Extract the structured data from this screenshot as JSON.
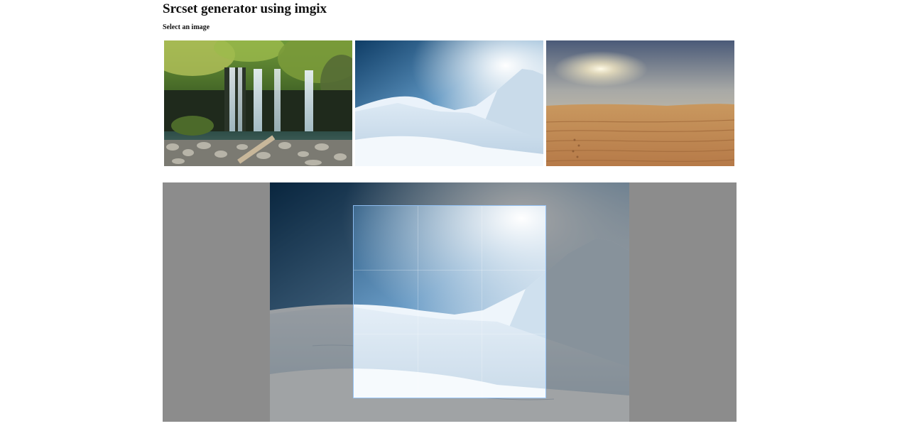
{
  "page": {
    "title": "Srcset generator using imgix",
    "subtitle": "Select an image"
  },
  "images": [
    {
      "name": "waterfall",
      "icon": "waterfall-image",
      "selected": false
    },
    {
      "name": "snow-mountain",
      "icon": "snow-mountain-image",
      "selected": true
    },
    {
      "name": "desert-dunes",
      "icon": "desert-image",
      "selected": false
    }
  ],
  "colors": {
    "cropper_background": "#8c8c8c",
    "crop_outline": "#96c8ff"
  }
}
